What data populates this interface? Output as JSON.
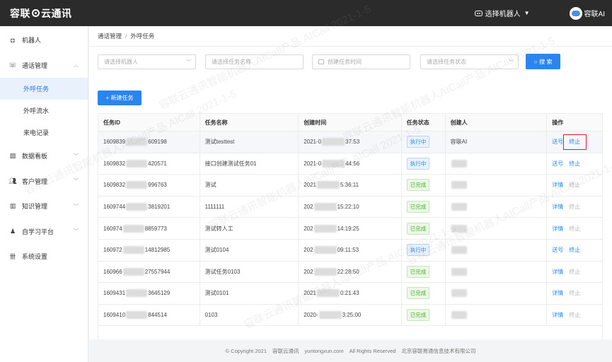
{
  "app": {
    "logo_left": "容联",
    "logo_right": "云通讯"
  },
  "topbar": {
    "robot_select": "选择机器人",
    "user_name": "容联AI"
  },
  "sidebar": {
    "items": [
      {
        "label": "机器人",
        "icon": "robot-icon"
      },
      {
        "label": "通话管理",
        "icon": "phone-icon",
        "expanded": true,
        "children": [
          {
            "label": "外呼任务",
            "active": true
          },
          {
            "label": "外呼流水"
          },
          {
            "label": "来电记录"
          }
        ]
      },
      {
        "label": "数据看板",
        "icon": "chart-icon"
      },
      {
        "label": "客户管理",
        "icon": "users-icon"
      },
      {
        "label": "知识管理",
        "icon": "book-icon"
      },
      {
        "label": "自学习平台",
        "icon": "person-icon"
      },
      {
        "label": "系统设置",
        "icon": "settings-icon"
      }
    ]
  },
  "breadcrumb": {
    "parent": "通话管理",
    "sep": "/",
    "current": "外呼任务"
  },
  "filters": {
    "robot": "请选择机器人",
    "task_name": "请选择任务名称",
    "created_time": "创建任务时间",
    "task_status": "请选择任务状态",
    "search_label": "搜 索"
  },
  "new_task_label": "+ 新建任务",
  "table": {
    "headers": [
      "任务ID",
      "任务名称",
      "创建时间",
      "任务状态",
      "创建人",
      "操作"
    ],
    "rows": [
      {
        "id_a": "1609839",
        "id_b": "609198",
        "name": "测试testtest",
        "t_a": "2021-0",
        "t_b": "37:53",
        "status": "执行中",
        "status_type": "running",
        "creator": "容联AI",
        "op1": "送号",
        "op2": "终止",
        "op2_active": true
      },
      {
        "id_a": "1609832",
        "id_b": "420571",
        "name": "接口创建测试任务01",
        "t_a": "2021-0",
        "t_b": "44:56",
        "status": "执行中",
        "status_type": "running",
        "creator": "",
        "op1": "送号",
        "op2": "终止",
        "op2_active": true
      },
      {
        "id_a": "1609832",
        "id_b": "996763",
        "name": "测试",
        "t_a": "2021",
        "t_b": "5:36:11",
        "status": "已完成",
        "status_type": "done",
        "creator": "",
        "op1": "详情",
        "op2": "终止",
        "op2_active": false
      },
      {
        "id_a": "1609744",
        "id_b": "3819201",
        "name": "1111111",
        "t_a": "202",
        "t_b": "15:22:10",
        "status": "已完成",
        "status_type": "done",
        "creator": "",
        "op1": "详情",
        "op2": "终止",
        "op2_active": false
      },
      {
        "id_a": "160974",
        "id_b": "8859773",
        "name": "测试转人工",
        "t_a": "202",
        "t_b": "14:19:25",
        "status": "已完成",
        "status_type": "done",
        "creator": "",
        "op1": "详情",
        "op2": "终止",
        "op2_active": false
      },
      {
        "id_a": "160972",
        "id_b": "14812985",
        "name": "测试0104",
        "t_a": "202",
        "t_b": "09:11:53",
        "status": "执行中",
        "status_type": "running",
        "creator": "",
        "op1": "送号",
        "op2": "终止",
        "op2_active": true
      },
      {
        "id_a": "160966",
        "id_b": "27557944",
        "name": "测试任务0103",
        "t_a": "202",
        "t_b": "22:28:50",
        "status": "已完成",
        "status_type": "done",
        "creator": "",
        "op1": "详情",
        "op2": "终止",
        "op2_active": false
      },
      {
        "id_a": "1609431",
        "id_b": "3645129",
        "name": "测试0101",
        "t_a": "2021",
        "t_b": "0:21:43",
        "status": "已完成",
        "status_type": "done",
        "creator": "",
        "op1": "详情",
        "op2": "终止",
        "op2_active": false
      },
      {
        "id_a": "1609410",
        "id_b": "844514",
        "name": "0103",
        "t_a": "2020-",
        "t_b": "3:25:00",
        "status": "已完成",
        "status_type": "done",
        "creator": "",
        "op1": "详情",
        "op2": "终止",
        "op2_active": false
      }
    ]
  },
  "footer": {
    "copyright": "© Copyright 2021",
    "brand": "容联云通讯",
    "domain": "yuntongxun.com",
    "rights": "All Rights Reserved",
    "company": "北京容联易通信息技术有限公司"
  },
  "watermark": "容联云通讯智能机器人AICall产品  AICall  2021-1-5",
  "colors": {
    "primary": "#2b85ec",
    "topbar": "#2b2b2b",
    "done": "#4caf2a",
    "highlight": "#e02020"
  }
}
